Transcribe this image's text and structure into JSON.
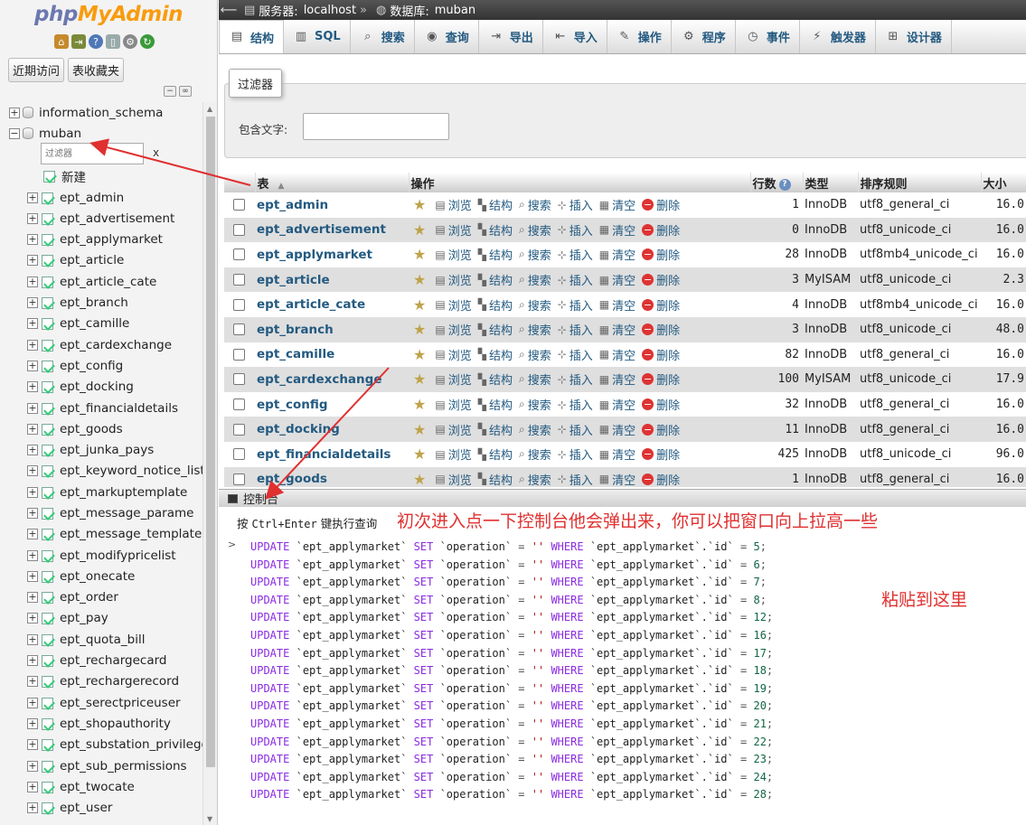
{
  "logo": {
    "part1": "php",
    "part2": "MyAdmin"
  },
  "quick_icons": [
    "home-icon",
    "exit-icon",
    "help-icon",
    "docs-icon",
    "settings-icon",
    "reload-icon"
  ],
  "nav_buttons": {
    "recent": "近期访问",
    "favorites": "表收藏夹"
  },
  "tree": {
    "databases": [
      {
        "name": "information_schema",
        "expander": "+"
      },
      {
        "name": "muban",
        "expander": "−"
      }
    ],
    "filter_placeholder": "过滤器",
    "filter_clear": "x",
    "new_label": "新建",
    "tables": [
      "ept_admin",
      "ept_advertisement",
      "ept_applymarket",
      "ept_article",
      "ept_article_cate",
      "ept_branch",
      "ept_camille",
      "ept_cardexchange",
      "ept_config",
      "ept_docking",
      "ept_financialdetails",
      "ept_goods",
      "ept_junka_pays",
      "ept_keyword_notice_list",
      "ept_markuptemplate",
      "ept_message_parame",
      "ept_message_template",
      "ept_modifypricelist",
      "ept_onecate",
      "ept_order",
      "ept_pay",
      "ept_quota_bill",
      "ept_rechargecard",
      "ept_rechargerecord",
      "ept_serectpriceuser",
      "ept_shopauthority",
      "ept_substation_privilege",
      "ept_sub_permissions",
      "ept_twocate",
      "ept_user"
    ]
  },
  "breadcrumb": {
    "server_label": "服务器:",
    "server": "localhost",
    "separator": "»",
    "db_label": "数据库:",
    "db": "muban"
  },
  "tabs": [
    {
      "label": "结构",
      "icon": "structure-icon",
      "glyph": "▤",
      "active": true
    },
    {
      "label": "SQL",
      "icon": "sql-icon",
      "glyph": "▥",
      "active": false
    },
    {
      "label": "搜索",
      "icon": "search-icon",
      "glyph": "⌕",
      "active": false
    },
    {
      "label": "查询",
      "icon": "query-icon",
      "glyph": "◉",
      "active": false
    },
    {
      "label": "导出",
      "icon": "export-icon",
      "glyph": "⇥",
      "active": false
    },
    {
      "label": "导入",
      "icon": "import-icon",
      "glyph": "⇤",
      "active": false
    },
    {
      "label": "操作",
      "icon": "operations-icon",
      "glyph": "✎",
      "active": false
    },
    {
      "label": "程序",
      "icon": "routines-icon",
      "glyph": "⚙",
      "active": false
    },
    {
      "label": "事件",
      "icon": "events-icon",
      "glyph": "◷",
      "active": false
    },
    {
      "label": "触发器",
      "icon": "triggers-icon",
      "glyph": "⚡",
      "active": false
    },
    {
      "label": "设计器",
      "icon": "designer-icon",
      "glyph": "⊞",
      "active": false
    }
  ],
  "filter": {
    "legend": "过滤器",
    "contains_label": "包含文字:",
    "value": ""
  },
  "table": {
    "headers": {
      "table": "表",
      "action": "操作",
      "rows": "行数",
      "type": "类型",
      "collation": "排序规则",
      "size": "大小"
    },
    "actions": {
      "browse": "浏览",
      "structure": "结构",
      "search": "搜索",
      "insert": "插入",
      "empty": "清空",
      "drop": "删除"
    },
    "rows": [
      {
        "name": "ept_admin",
        "rows": "1",
        "type": "InnoDB",
        "collation": "utf8_general_ci",
        "size": "16.0"
      },
      {
        "name": "ept_advertisement",
        "rows": "0",
        "type": "InnoDB",
        "collation": "utf8_unicode_ci",
        "size": "16.0"
      },
      {
        "name": "ept_applymarket",
        "rows": "28",
        "type": "InnoDB",
        "collation": "utf8mb4_unicode_ci",
        "size": "16.0"
      },
      {
        "name": "ept_article",
        "rows": "3",
        "type": "MyISAM",
        "collation": "utf8_unicode_ci",
        "size": "2.3"
      },
      {
        "name": "ept_article_cate",
        "rows": "4",
        "type": "InnoDB",
        "collation": "utf8mb4_unicode_ci",
        "size": "16.0"
      },
      {
        "name": "ept_branch",
        "rows": "3",
        "type": "InnoDB",
        "collation": "utf8_unicode_ci",
        "size": "48.0"
      },
      {
        "name": "ept_camille",
        "rows": "82",
        "type": "InnoDB",
        "collation": "utf8_general_ci",
        "size": "16.0"
      },
      {
        "name": "ept_cardexchange",
        "rows": "100",
        "type": "MyISAM",
        "collation": "utf8_unicode_ci",
        "size": "17.9"
      },
      {
        "name": "ept_config",
        "rows": "32",
        "type": "InnoDB",
        "collation": "utf8_general_ci",
        "size": "16.0"
      },
      {
        "name": "ept_docking",
        "rows": "11",
        "type": "InnoDB",
        "collation": "utf8_general_ci",
        "size": "16.0"
      },
      {
        "name": "ept_financialdetails",
        "rows": "425",
        "type": "InnoDB",
        "collation": "utf8_unicode_ci",
        "size": "96.0"
      },
      {
        "name": "ept_goods",
        "rows": "1",
        "type": "InnoDB",
        "collation": "utf8_general_ci",
        "size": "16.0"
      }
    ]
  },
  "console": {
    "title": "控制台",
    "hint_pre": "按",
    "hint_keys": "Ctrl+Enter",
    "hint_post": "键执行查询",
    "prompt": ">",
    "sql": {
      "kw1": "UPDATE",
      "table": "`ept_applymarket`",
      "kw2": "SET",
      "col": "`operation`",
      "eq": "=",
      "val": "''",
      "kw3": "WHERE",
      "idref": "`ept_applymarket`.`id`"
    },
    "ids": [
      "5",
      "6",
      "7",
      "8",
      "12",
      "16",
      "17",
      "18",
      "19",
      "20",
      "21",
      "22",
      "23",
      "24",
      "28"
    ]
  },
  "annotations": {
    "main": "初次进入点一下控制台他会弹出来，你可以把窗口向上拉高一些",
    "paste": "粘贴到这里",
    "color": "#e03030"
  }
}
